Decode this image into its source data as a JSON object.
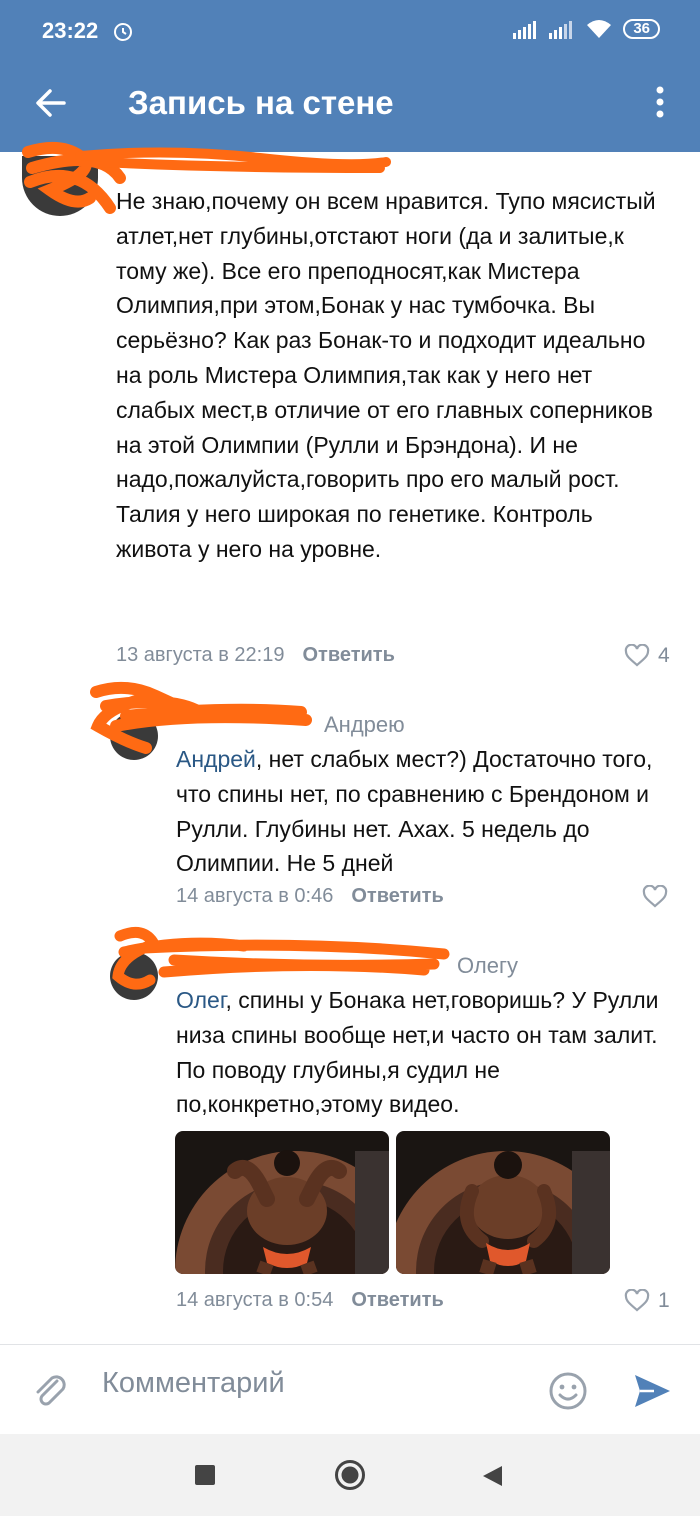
{
  "status": {
    "time": "23:22",
    "battery": "36"
  },
  "appbar": {
    "title": "Запись на стене",
    "back_icon": "arrow-left-icon",
    "more_icon": "more-vertical-icon"
  },
  "comments": [
    {
      "text": "Не знаю,почему он всем нравится. Тупо мясистый атлет,нет глубины,отстают ноги (да и залитые,к тому же). Все его преподносят,как Мистера Олимпия,при этом,Бонак у нас тумбочка. Вы серьёзно? Как раз Бонак-то и подходит идеально на роль Мистера Олимпия,так как у него нет слабых мест,в отличие от его главных соперников на этой Олимпии (Рулли и Брэндона). И не надо,пожалуйста,говорить про его малый рост. Талия у него широкая по генетике. Контроль живота у него на уровне.",
      "date": "13 августа в 22:19",
      "reply": "Ответить",
      "likes": "4"
    },
    {
      "reply_to": "Андрею",
      "mention": "Андрей",
      "text": ", нет слабых мест?) Достаточно того, что спины нет, по сравнению с Брендоном и Рулли. Глубины нет. Ахах. 5 недель до Олимпии. Не 5 дней",
      "date": "14 августа в 0:46",
      "reply": "Ответить",
      "likes": ""
    },
    {
      "reply_to": "Олегу",
      "mention": "Олег",
      "text": ", спины у Бонака нет,говоришь? У Рулли низа спины вообще нет,и часто он там залит. По поводу глубины,я судил не по,конкретно,этому видео.",
      "date": "14 августа в 0:54",
      "reply": "Ответить",
      "likes": "1"
    }
  ],
  "composer": {
    "placeholder": "Комментарий",
    "attach_icon": "paperclip-icon",
    "emoji_icon": "smile-icon",
    "send_icon": "send-icon"
  },
  "colors": {
    "header": "#5181b8",
    "link": "#2a5885",
    "meta": "#818c99",
    "scribble": "#ff6a13"
  }
}
